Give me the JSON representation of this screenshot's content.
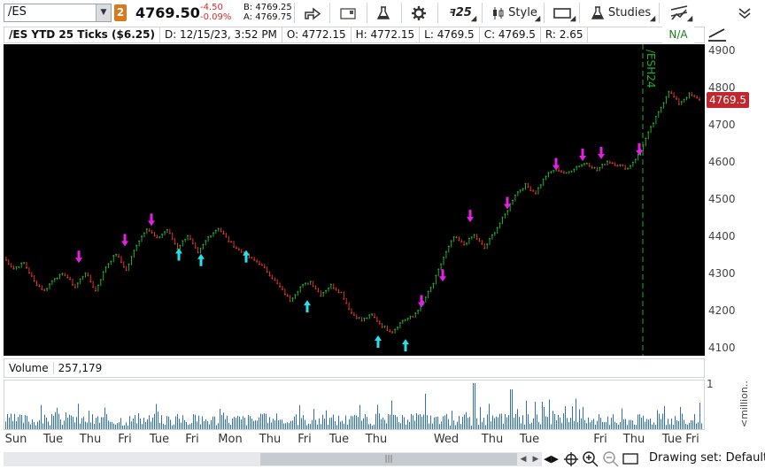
{
  "toolbar": {
    "symbol": "/ES",
    "link_number": "2",
    "last_price": "4769.50",
    "net_change": "-4.50",
    "pct_change": "-0.09%",
    "bid": "B: 4769.25",
    "ask": "A: 4769.75",
    "aggregation_label": "25",
    "style_label": "Style",
    "studies_label": "Studies"
  },
  "infobar": {
    "title": "/ES YTD 25 Ticks ($6.25)",
    "date": "D: 12/15/23, 3:52 PM",
    "open": "O: 4772.15",
    "high": "H: 4772.15",
    "low": "L: 4769.5",
    "close": "C: 4769.5",
    "range": "R: 2.65",
    "status": "N/A"
  },
  "price_axis": {
    "ticks": [
      "4900",
      "4800",
      "4700",
      "4600",
      "4500",
      "4400",
      "4300",
      "4200",
      "4100"
    ],
    "last_tag": "4769.5"
  },
  "rollover_label": "/ESH24",
  "volume": {
    "label": "Volume",
    "value": "257,179",
    "axis_top": "1",
    "axis_unit": "<million..."
  },
  "time_axis": [
    "Sun",
    "Tue",
    "Thu",
    "Fri",
    "Tue",
    "Fri",
    "Mon",
    "Thu",
    "Fri",
    "Tue",
    "Thu",
    "Wed",
    "Thu",
    "Tue",
    "Fri",
    "Thu",
    "Tue",
    "Fri"
  ],
  "bottombar": {
    "drawing_set": "Drawing set: Default"
  },
  "colors": {
    "up": "#1fae2a",
    "down": "#e0332b",
    "sell_arrow": "#e61ee6",
    "buy_arrow": "#27e0e8",
    "volume_bar": "#2f6fbf",
    "last_tag": "#c1272d",
    "rollover_line": "#1fae2a"
  },
  "chart_data": {
    "type": "line",
    "title": "/ES YTD 25 Ticks ($6.25)",
    "ylim": [
      4080,
      4920
    ],
    "price_path": [
      4345,
      4315,
      4330,
      4280,
      4255,
      4290,
      4300,
      4265,
      4305,
      4255,
      4320,
      4355,
      4310,
      4380,
      4425,
      4395,
      4420,
      4370,
      4405,
      4355,
      4400,
      4425,
      4390,
      4365,
      4345,
      4330,
      4300,
      4265,
      4230,
      4265,
      4280,
      4245,
      4270,
      4250,
      4195,
      4175,
      4190,
      4160,
      4145,
      4175,
      4185,
      4225,
      4275,
      4345,
      4400,
      4380,
      4405,
      4370,
      4415,
      4460,
      4515,
      4540,
      4520,
      4565,
      4585,
      4570,
      4590,
      4600,
      4580,
      4605,
      4595,
      4585,
      4620,
      4680,
      4735,
      4795,
      4760,
      4785,
      4770
    ],
    "sell_arrows": [
      4330,
      4375,
      4430,
      4210,
      4280,
      4440,
      4475,
      4580,
      4605,
      4610,
      4620
    ],
    "buy_arrows": [
      4370,
      4355,
      4365,
      4230,
      4135,
      4125
    ],
    "last": 4769.5
  }
}
